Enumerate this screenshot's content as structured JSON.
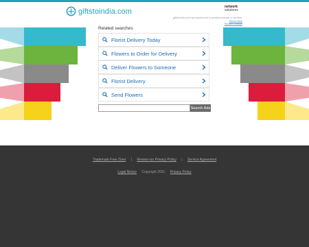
{
  "header": {
    "site_name": "giftstoindia.com",
    "partner_logo_line1": "network",
    "partner_logo_line2": "solutions",
    "notice_text": "giftstoindia.com has expired and is pending renewal or deletion.",
    "renew_link": "Renew Now",
    "reclaim_link": "Reclaim Domain"
  },
  "related": {
    "title": "Related searches",
    "items": [
      {
        "label": "Florist Delivery Today"
      },
      {
        "label": "Flowers to Order for Delivery"
      },
      {
        "label": "Deliver Flowers to Someone"
      },
      {
        "label": "Florist Delivery"
      },
      {
        "label": "Send Flowers"
      }
    ]
  },
  "search": {
    "value": "",
    "placeholder": "",
    "button_label": "Search Ads"
  },
  "footer": {
    "link1": "Trademark Free Zone",
    "link2": "Review our Privacy Policy",
    "link3": "Service Agreement",
    "link4": "Legal Notice",
    "copyright": "Copyright 2021",
    "privacy": "Privacy Policy"
  },
  "colors": {
    "accent": "#1fa3b5",
    "link": "#1d6bb6",
    "footer_bg": "#353535",
    "stripes_left": [
      "#35b9cc",
      "#6cb43e",
      "#8a8a8a",
      "#dc1c3c",
      "#f7d21a"
    ],
    "stripes_light_left": [
      "#a3dce6",
      "#b6d99c",
      "#c3c3c3",
      "#f0a0ac",
      "#fbe98c"
    ]
  }
}
